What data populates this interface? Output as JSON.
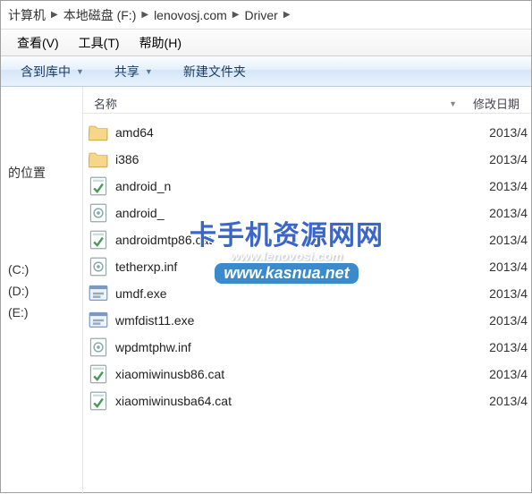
{
  "breadcrumb": {
    "items": [
      "计算机",
      "本地磁盘 (F:)",
      "lenovosj.com",
      "Driver"
    ]
  },
  "menu": {
    "view": "查看(V)",
    "tools": "工具(T)",
    "help": "帮助(H)"
  },
  "toolbar": {
    "include": "含到库中",
    "share": "共享",
    "newfolder": "新建文件夹"
  },
  "columns": {
    "name": "名称",
    "date": "修改日期"
  },
  "nav": {
    "location": "的位置",
    "drives": [
      "(C:)",
      "(D:)",
      "(E:)"
    ]
  },
  "files": [
    {
      "name": "amd64",
      "type": "folder",
      "date": "2013/4"
    },
    {
      "name": "i386",
      "type": "folder",
      "date": "2013/4"
    },
    {
      "name": "android_n",
      "type": "cat",
      "date": "2013/4"
    },
    {
      "name": "android_",
      "type": "inf",
      "date": "2013/4"
    },
    {
      "name": "androidmtp86.cat",
      "type": "cat",
      "date": "2013/4"
    },
    {
      "name": "tetherxp.inf",
      "type": "inf",
      "date": "2013/4"
    },
    {
      "name": "umdf.exe",
      "type": "exe",
      "date": "2013/4"
    },
    {
      "name": "wmfdist11.exe",
      "type": "exe",
      "date": "2013/4"
    },
    {
      "name": "wpdmtphw.inf",
      "type": "inf",
      "date": "2013/4"
    },
    {
      "name": "xiaomiwinusb86.cat",
      "type": "cat",
      "date": "2013/4"
    },
    {
      "name": "xiaomiwinusba64.cat",
      "type": "cat",
      "date": "2013/4"
    }
  ],
  "watermark": {
    "line1": "卡手机资源网网",
    "line2": "www.lenovosj.com",
    "line3": "www.kasnua.net"
  }
}
